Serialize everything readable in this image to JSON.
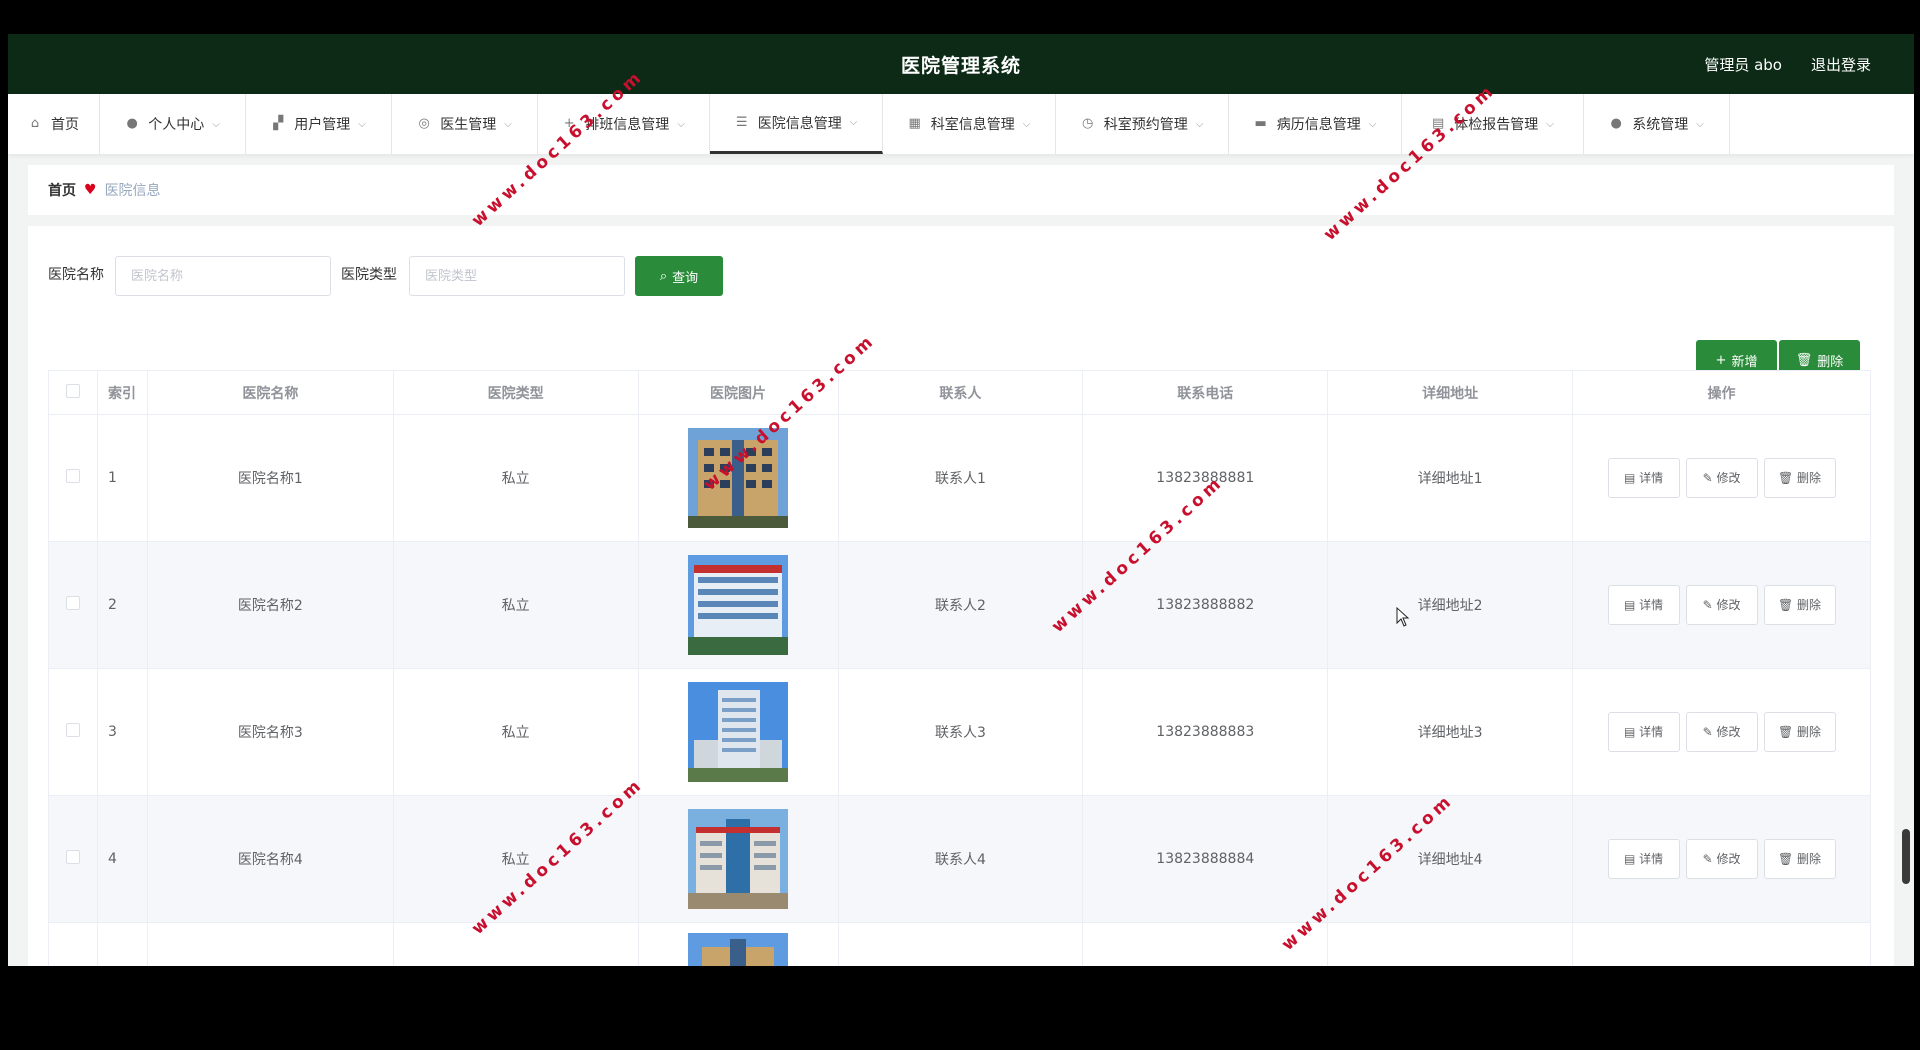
{
  "app": {
    "title": "医院管理系统",
    "user": "管理员 abo",
    "logout": "退出登录"
  },
  "nav": [
    {
      "label": "首页",
      "icon": "home-icon"
    },
    {
      "label": "个人中心",
      "icon": "user-icon"
    },
    {
      "label": "用户管理",
      "icon": "users-icon"
    },
    {
      "label": "医生管理",
      "icon": "doctor-icon"
    },
    {
      "label": "排班信息管理",
      "icon": "schedule-icon"
    },
    {
      "label": "医院信息管理",
      "icon": "sliders-icon"
    },
    {
      "label": "科室信息管理",
      "icon": "grid-icon"
    },
    {
      "label": "科室预约管理",
      "icon": "clock-icon"
    },
    {
      "label": "病历信息管理",
      "icon": "record-icon"
    },
    {
      "label": "体检报告管理",
      "icon": "report-icon"
    },
    {
      "label": "系统管理",
      "icon": "settings-user-icon"
    }
  ],
  "breadcrumb": {
    "home": "首页",
    "current": "医院信息"
  },
  "search": {
    "name_label": "医院名称",
    "name_placeholder": "医院名称",
    "type_label": "医院类型",
    "type_placeholder": "医院类型",
    "query_button": "查询"
  },
  "actions": {
    "add": "新增",
    "delete": "删除"
  },
  "table": {
    "headers": [
      "索引",
      "医院名称",
      "医院类型",
      "医院图片",
      "联系人",
      "联系电话",
      "详细地址",
      "操作"
    ],
    "row_buttons": {
      "detail": "详情",
      "edit": "修改",
      "delete": "删除"
    },
    "rows": [
      {
        "index": "1",
        "name": "医院名称1",
        "type": "私立",
        "contact": "联系人1",
        "phone": "13823888881",
        "address": "详细地址1"
      },
      {
        "index": "2",
        "name": "医院名称2",
        "type": "私立",
        "contact": "联系人2",
        "phone": "13823888882",
        "address": "详细地址2"
      },
      {
        "index": "3",
        "name": "医院名称3",
        "type": "私立",
        "contact": "联系人3",
        "phone": "13823888883",
        "address": "详细地址3"
      },
      {
        "index": "4",
        "name": "医院名称4",
        "type": "私立",
        "contact": "联系人4",
        "phone": "13823888884",
        "address": "详细地址4"
      }
    ]
  },
  "watermark": "www.doc163.com",
  "colors": {
    "topbar": "#0c2a15",
    "accent": "#2a8c3a",
    "watermark": "#c8102e"
  }
}
